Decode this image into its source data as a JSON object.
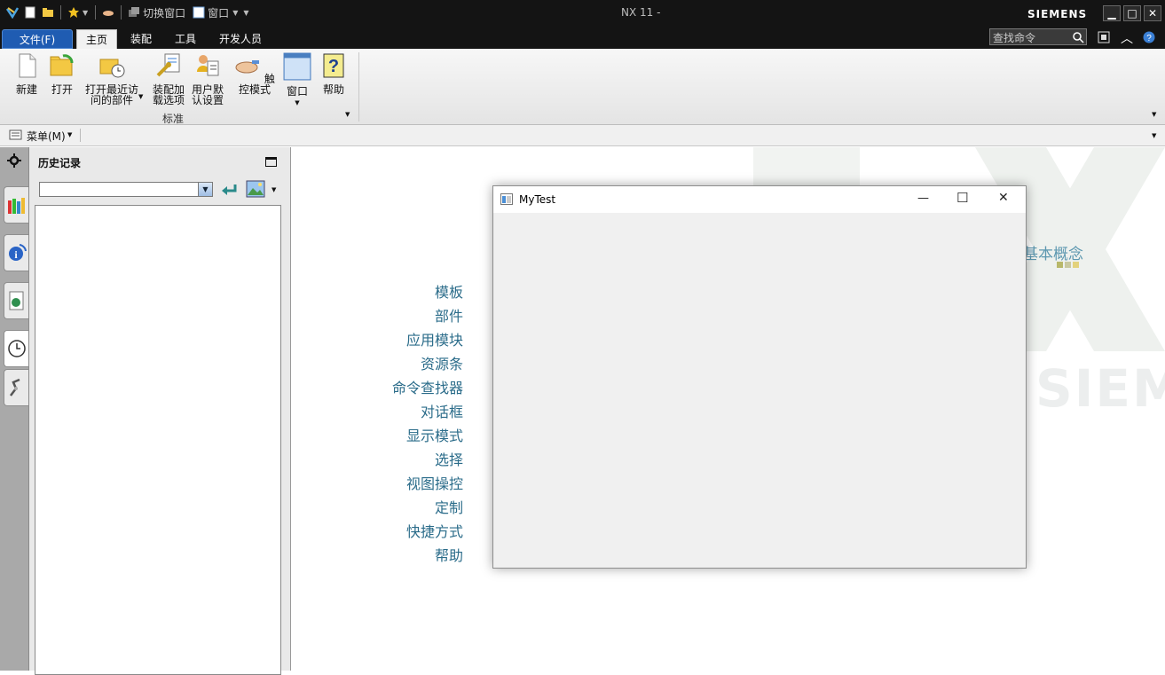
{
  "titlebar": {
    "quick_access": {
      "switch_window": "切换窗口",
      "window": "窗口"
    },
    "title": "NX 11 -",
    "brand": "SIEMENS",
    "controls": {
      "minimize": "▁",
      "maximize": "□",
      "close": "✕"
    }
  },
  "tabs": [
    {
      "label": "文件(F)"
    },
    {
      "label": "主页"
    },
    {
      "label": "装配"
    },
    {
      "label": "工具"
    },
    {
      "label": "开发人员"
    }
  ],
  "search": {
    "placeholder": "查找命令"
  },
  "ribbon": {
    "buttons": [
      {
        "label": "新建"
      },
      {
        "label": "打开"
      },
      {
        "label_line1": "打开最近访",
        "label_line2": "问的部件"
      },
      {
        "label_line1": "装配加",
        "label_line2": "载选项"
      },
      {
        "label_line1": "用户默",
        "label_line2": "认设置"
      },
      {
        "label": "触控模式"
      },
      {
        "label": "窗口"
      },
      {
        "label": "帮助"
      }
    ],
    "group_label": "标准"
  },
  "menubar": {
    "menu_label": "菜单(M)"
  },
  "history_panel": {
    "title": "历史记录"
  },
  "main": {
    "links": [
      "模板",
      "部件",
      "应用模块",
      "资源条",
      "命令查找器",
      "对话框",
      "显示模式",
      "选择",
      "视图操控",
      "定制",
      "快捷方式",
      "帮助"
    ],
    "concept_text": "基本概念",
    "watermark_letters": "NX",
    "watermark_brand": "SIEMENS"
  },
  "dialog": {
    "title": "MyTest",
    "controls": {
      "minimize": "—",
      "maximize": "☐",
      "close": "✕"
    }
  },
  "colors": {
    "titlebar_bg": "#141414",
    "file_tab_bg": "#1f5cb2",
    "link_color": "#2b6c8a",
    "dialog_bg": "#f0f0f0"
  }
}
